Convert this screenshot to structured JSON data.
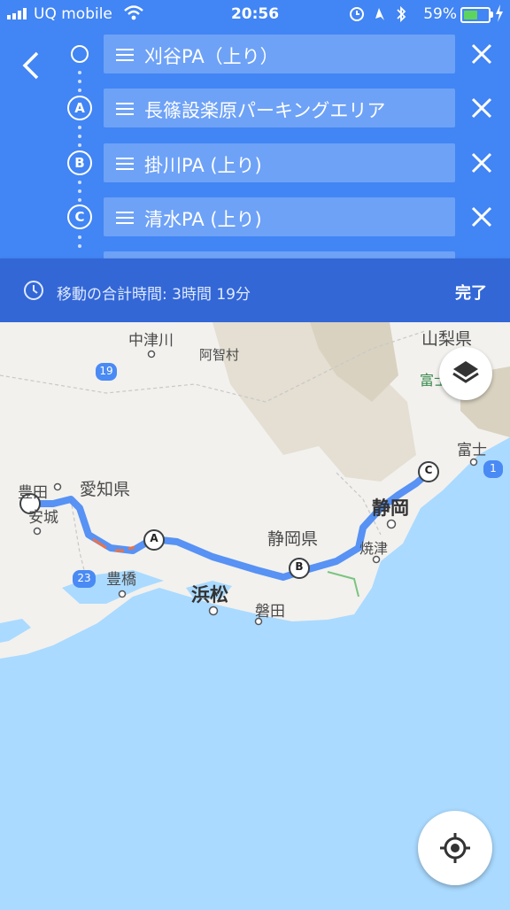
{
  "status_bar": {
    "carrier": "UQ mobile",
    "time": "20:56",
    "battery_percent": "59%",
    "battery_level": 0.59
  },
  "waypoints": [
    {
      "marker": "",
      "label": "刈谷PA（上り）"
    },
    {
      "marker": "A",
      "label": "長篠設楽原パーキングエリア"
    },
    {
      "marker": "B",
      "label": "掛川PA (上り)"
    },
    {
      "marker": "C",
      "label": "清水PA (上り)"
    }
  ],
  "summary": {
    "text": "移動の合計時間: 3時間 19分",
    "done_label": "完了"
  },
  "map": {
    "labels": {
      "nakatsugawa": "中津川",
      "achi": "阿智村",
      "yamanashi": "山梨県",
      "fuji_partial": "富士",
      "toyota": "豊田",
      "aichi": "愛知県",
      "anjo": "安城",
      "fuji": "富士",
      "shizuoka_city": "静岡",
      "shizuoka_pref": "静岡県",
      "yaizu": "焼津",
      "toyohashi": "豊橋",
      "hamamatsu": "浜松",
      "iwata": "磐田"
    },
    "routes": {
      "r19": "19",
      "r23": "23",
      "r1": "1"
    },
    "markers": {
      "a": "A",
      "b": "B",
      "c": "C"
    },
    "colors": {
      "route": "#4a8af4",
      "sea": "#aadaff",
      "land": "#f2f1ee",
      "mountain": "#d9d2c0"
    }
  },
  "icons": {
    "back": "chevron-left-icon",
    "remove": "close-icon",
    "clock": "clock-icon",
    "layers": "layers-icon",
    "my_location": "my-location-icon"
  }
}
